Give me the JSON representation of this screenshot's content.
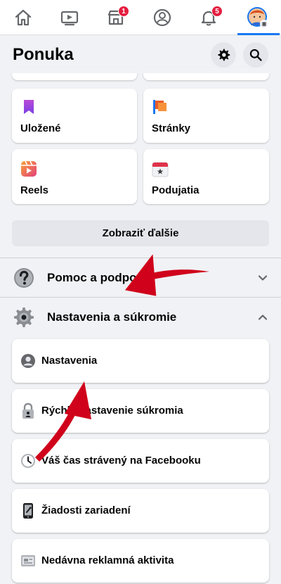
{
  "topnav": {
    "items": [
      {
        "name": "home-icon"
      },
      {
        "name": "video-icon"
      },
      {
        "name": "marketplace-icon",
        "badge": "1"
      },
      {
        "name": "profile-icon"
      },
      {
        "name": "bell-icon",
        "badge": "5"
      },
      {
        "name": "menu-avatar-icon",
        "active": true
      }
    ],
    "accent": "#1877f2",
    "badge_color": "#e41e3f"
  },
  "header": {
    "title": "Ponuka",
    "settings_icon": "gear-icon",
    "search_icon": "search-icon"
  },
  "shortcuts": [
    {
      "label": "Uložené",
      "icon": "bookmark-icon"
    },
    {
      "label": "Stránky",
      "icon": "flag-icon"
    },
    {
      "label": "Reels",
      "icon": "reels-icon"
    },
    {
      "label": "Podujatia",
      "icon": "calendar-icon"
    }
  ],
  "more_button": "Zobraziť ďalšie",
  "sections": {
    "help": {
      "label": "Pomoc a podpora",
      "icon": "question-icon",
      "expanded": false
    },
    "settings": {
      "label": "Nastavenia a súkromie",
      "icon": "gear-icon",
      "expanded": true
    }
  },
  "settings_items": [
    {
      "label": "Nastavenia",
      "icon": "user-circle-icon"
    },
    {
      "label": "Rýchle nastavenie súkromia",
      "icon": "lock-icon"
    },
    {
      "label": "Váš čas strávený na Facebooku",
      "icon": "clock-icon"
    },
    {
      "label": "Žiadosti zariadení",
      "icon": "phone-icon"
    },
    {
      "label": "Nedávna reklamná aktivita",
      "icon": "ad-icon"
    }
  ],
  "annotation_color": "#d0021b"
}
